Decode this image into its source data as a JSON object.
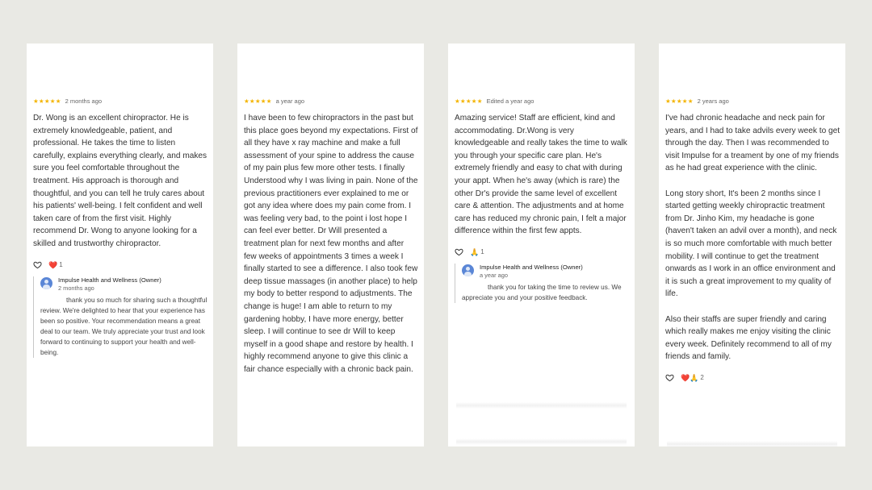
{
  "reviews": [
    {
      "stars": "★★★★★",
      "date": "2 months ago",
      "text": "Dr. Wong is an excellent chiropractor. He is extremely knowledgeable, patient, and professional. He takes the time to listen carefully, explains everything clearly, and makes sure you feel comfortable throughout the treatment. His approach is thorough and thoughtful, and you can tell he truly cares about his patients' well-being. I felt confident and well taken care of from the first visit. Highly recommend Dr. Wong to anyone looking for a skilled and trustworthy chiropractor.",
      "reaction_emoji": "❤️",
      "reaction_count": "1",
      "reply": {
        "owner": "Impulse Health and Wellness (Owner)",
        "date": "2 months ago",
        "text": "thank you so much for sharing such a thoughtful review. We're delighted to hear that your experience has been so positive. Your recommendation means a great deal to our team. We truly appreciate your trust and look forward to continuing to support your health and well-being."
      }
    },
    {
      "stars": "★★★★★",
      "date": "a year ago",
      "text": "I have been to few chiropractors in the past but this place goes beyond my expectations. First of all they have x ray machine and make a full assessment of your spine to address the cause of my pain plus few more other tests. I finally\nUnderstood why I was living in pain. None of the previous practitioners ever explained to me or got any idea where does my pain come from. I was feeling very bad, to the point i lost hope I can feel ever better. Dr Will presented a treatment plan for next few months and after few weeks of appointments 3 times a week I finally started to see a difference. I also took few deep tissue massages (in another place) to help my body to better respond to adjustments. The change is huge! I am able to return to my gardening hobby, I have more energy, better sleep. I will continue to see dr Will to keep myself in a good shape and restore by health. I highly recommend anyone to give this clinic a fair chance especially with a chronic back pain."
    },
    {
      "stars": "★★★★★",
      "date": "Edited a year ago",
      "text": "Amazing service! Staff are efficient, kind and accommodating. Dr.Wong is very knowledgeable and really takes the time to walk you through your specific care plan. He's extremely friendly and easy to chat with during your appt. When he's away (which is rare) the other Dr's provide the same level of excellent care & attention. The adjustments and at home care has reduced my chronic pain, I felt a major difference within the first few appts.",
      "reaction_emoji": "🙏",
      "reaction_count": "1",
      "reply": {
        "owner": "Impulse Health and Wellness (Owner)",
        "date": "a year ago",
        "text": "thank you for taking the time to review us. We appreciate you and your positive feedback."
      }
    },
    {
      "stars": "★★★★★",
      "date": "2 years ago",
      "text": "I've had chronic headache and neck pain for years, and I had to take advils every week to get through the day. Then I was recommended to visit Impulse for a treament by one of my friends as he had great experience with the clinic.\n\nLong story short, It's been 2 months since I started getting weekly chiropractic treatment from Dr. Jinho Kim, my headache is gone (haven't taken an advil over a month), and neck is so much more comfortable with much better mobility. I will continue to get the treatment onwards as I work in an office environment and it is such a great improvement to my quality of life.\n\nAlso their staffs are super friendly and caring which really makes me enjoy visiting the clinic every week. Definitely recommend to all of my friends and family.",
      "reaction_emoji": "❤️🙏",
      "reaction_count": "2"
    }
  ]
}
